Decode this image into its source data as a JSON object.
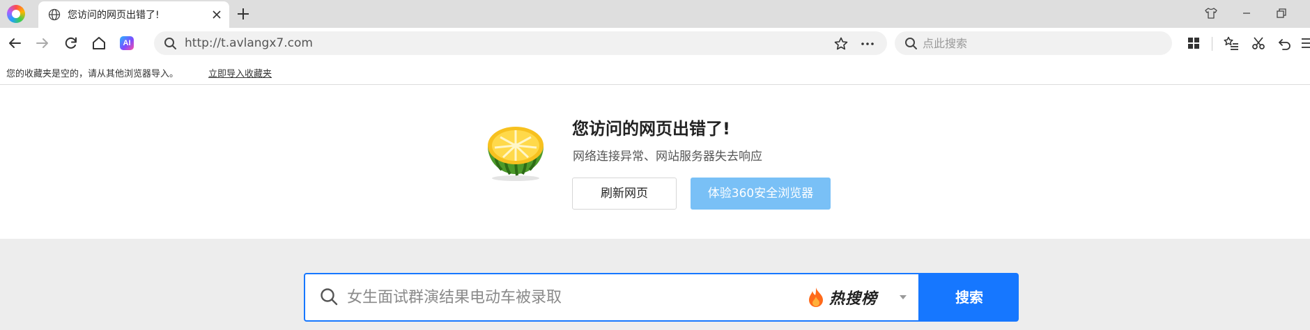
{
  "tab": {
    "title": "您访问的网页出错了!"
  },
  "address_bar": {
    "url": "http://t.avlangx7.com"
  },
  "search_box": {
    "placeholder": "点此搜索"
  },
  "bookmarks_bar": {
    "empty_text": "您的收藏夹是空的，请从其他浏览器导入。",
    "import_link": "立即导入收藏夹"
  },
  "error_page": {
    "title": "您访问的网页出错了!",
    "subtitle": "网络连接异常、网站服务器失去响应",
    "refresh_button": "刷新网页",
    "try_browser_button": "体验360安全浏览器"
  },
  "bottom_search": {
    "placeholder": "女生面试群演结果电动车被录取",
    "hot_label": "热搜榜",
    "search_button": "搜索"
  },
  "colors": {
    "accent": "#1677ff",
    "secondary_button": "#79c0f6",
    "band_background": "#ededed",
    "tabbar_background": "#dedede"
  }
}
